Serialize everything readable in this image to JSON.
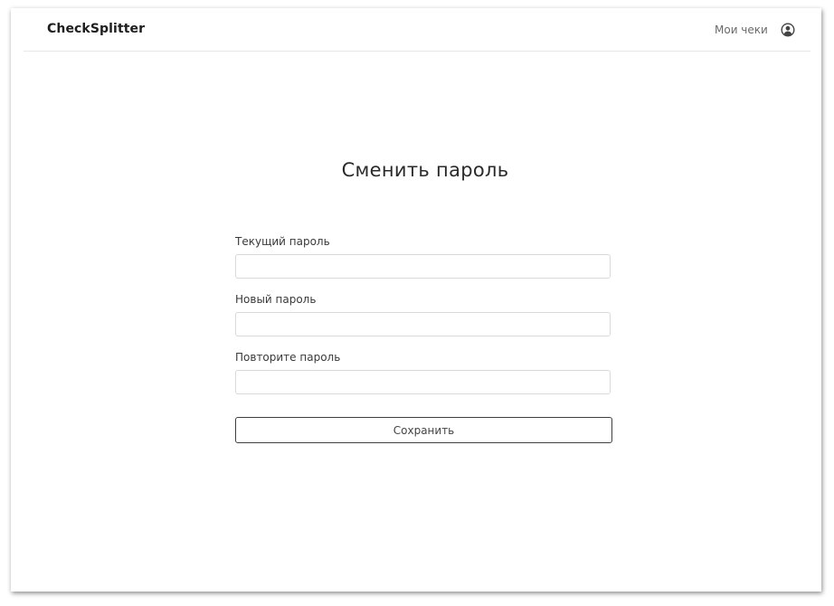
{
  "header": {
    "brand": "CheckSplitter",
    "nav_link": "Мои чеки",
    "user_icon": "user-circle-icon"
  },
  "form": {
    "title": "Сменить пароль",
    "current_password_label": "Текущий пароль",
    "current_password_value": "",
    "new_password_label": "Новый пароль",
    "new_password_value": "",
    "repeat_password_label": "Повторите пароль",
    "repeat_password_value": "",
    "save_label": "Сохранить"
  }
}
